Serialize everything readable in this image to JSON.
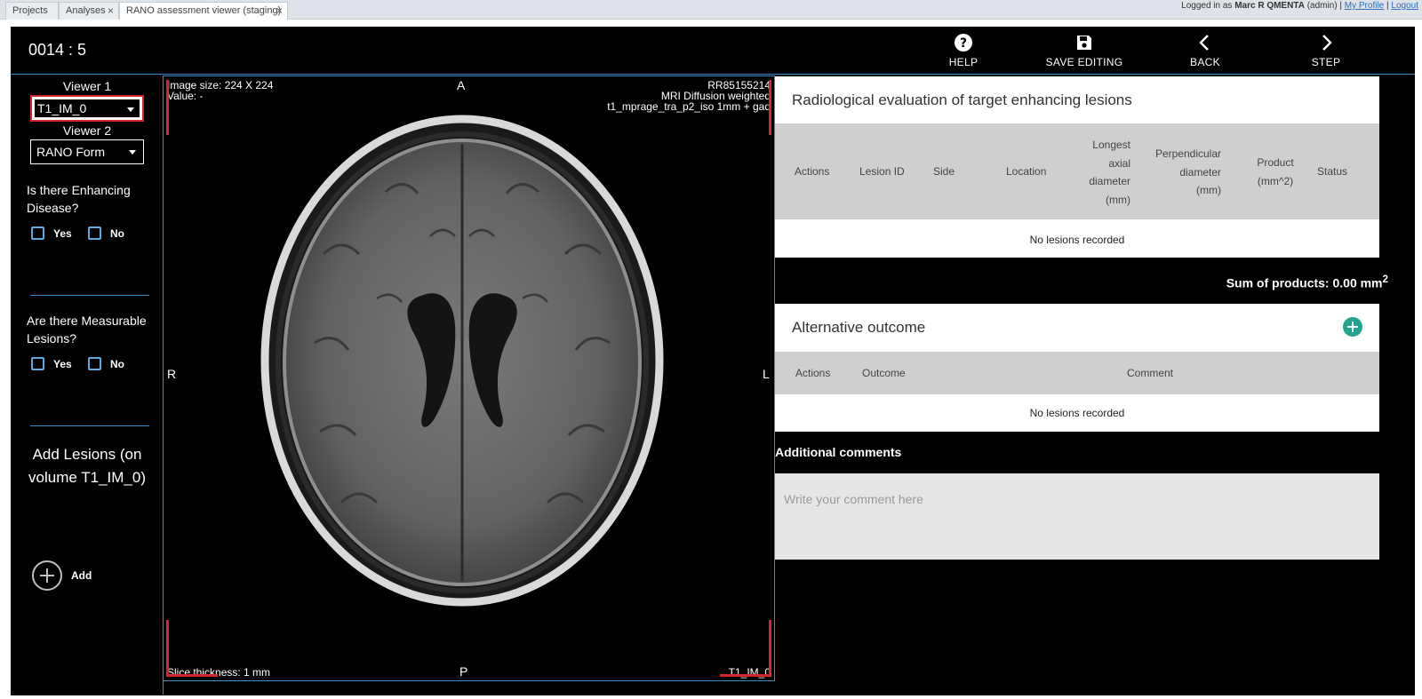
{
  "tabs": [
    {
      "label": "Projects"
    },
    {
      "label": "Analyses"
    },
    {
      "label": "RANO assessment viewer (staging)"
    }
  ],
  "tab_close_glyph": "×",
  "user": {
    "prefix": "Logged in as",
    "name": "Marc R QMENTA",
    "role": "(admin)",
    "sep": "|",
    "profile": "My Profile",
    "logout": "Logout"
  },
  "header": {
    "case_id": "0014 : 5",
    "help": "HELP",
    "save": "SAVE EDITING",
    "back": "BACK",
    "step": "STEP"
  },
  "left": {
    "viewer1_label": "Viewer 1",
    "viewer1_value": "T1_IM_0",
    "viewer2_label": "Viewer 2",
    "viewer2_value": "RANO Form",
    "q1": "Is there Enhancing Disease?",
    "q2": "Are there Measurable Lesions?",
    "yes": "Yes",
    "no": "No",
    "add_title": "Add Lesions (on volume T1_IM_0)",
    "add_label": "Add"
  },
  "viewer": {
    "image_size": "Image size: 224 X 224",
    "value": "Value: -",
    "subject_id": "RR85155214",
    "modality": "MRI Diffusion weighted",
    "sequence": "t1_mprage_tra_p2_iso 1mm + gad",
    "orient_a": "A",
    "orient_p": "P",
    "orient_r": "R",
    "orient_l": "L",
    "slice_thickness": "Slice thickness: 1 mm",
    "volume": "T1_IM_0"
  },
  "rano": {
    "title": "Radiological evaluation of target enhancing lesions",
    "columns": {
      "actions": "Actions",
      "lesion_id": "Lesion ID",
      "side": "Side",
      "location": "Location",
      "longest_1": "Longest",
      "longest_2": "axial",
      "longest_3": "diameter",
      "longest_4": "(mm)",
      "perp_1": "Perpendicular",
      "perp_2": "diameter",
      "perp_3": "(mm)",
      "product_1": "Product",
      "product_2": "(mm^2)",
      "status": "Status"
    },
    "empty": "No lesions recorded",
    "sum_label": "Sum of products: 0.00 mm",
    "sum_sup": "2"
  },
  "alt": {
    "title": "Alternative outcome",
    "columns": {
      "actions": "Actions",
      "outcome": "Outcome",
      "comment": "Comment"
    },
    "empty": "No lesions recorded"
  },
  "comments": {
    "label": "Additional comments",
    "placeholder": "Write your comment here"
  },
  "colors": {
    "accent": "#3a8fc7",
    "alert": "#d6252b",
    "add_button": "#22a390"
  }
}
